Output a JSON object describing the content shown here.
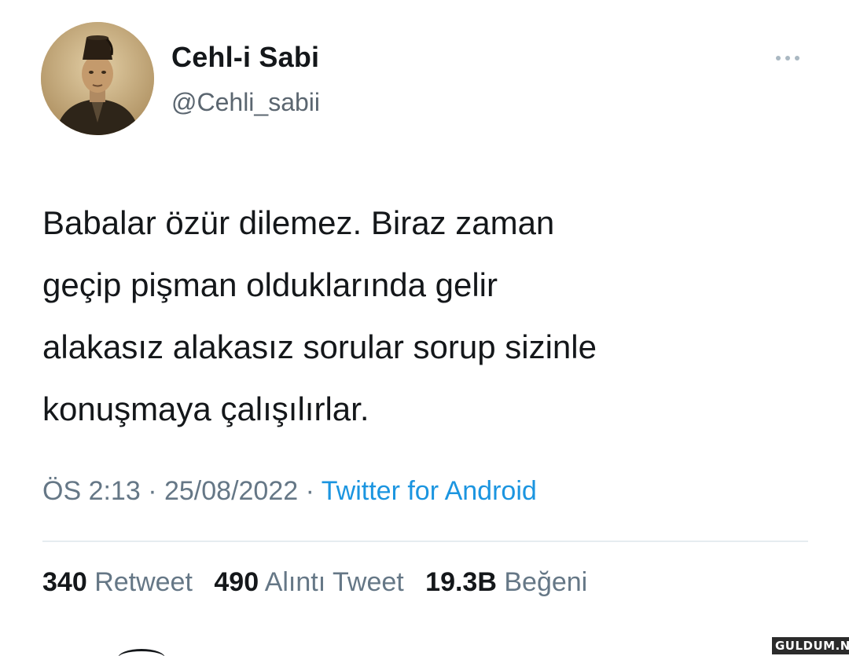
{
  "author": {
    "display_name": "Cehl-i Sabi",
    "handle": "@Cehli_sabii",
    "avatar_icon": "profile-photo"
  },
  "tweet": {
    "text": "Babalar özür dilemez. Biraz zaman\ngeçip pişman olduklarında gelir\nalakasız alakasız sorular sorup sizinle\nkonuşmaya çalışılırlar."
  },
  "meta": {
    "time": "ÖS 2:13",
    "separator": "·",
    "date": "25/08/2022",
    "source": "Twitter for Android"
  },
  "stats": {
    "retweets": {
      "count": "340",
      "label": "Retweet"
    },
    "quotes": {
      "count": "490",
      "label": "Alıntı Tweet"
    },
    "likes": {
      "count": "19.3B",
      "label": "Beğeni"
    }
  },
  "watermark": "GULDUM.NET",
  "colors": {
    "text": "#14171a",
    "secondary": "#657786",
    "link": "#1b95e0",
    "divider": "#e6ecf0"
  }
}
